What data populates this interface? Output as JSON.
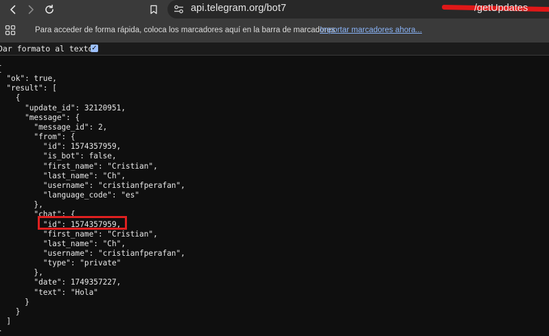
{
  "browser": {
    "url_start": "api.telegram.org/bot7",
    "url_end": "/getUpdates",
    "icons": {
      "back": "arrow-left-icon",
      "forward": "arrow-right-icon",
      "reload": "reload-icon",
      "bookmark": "bookmark-icon",
      "site_info": "tune-icon",
      "apps": "apps-grid-icon"
    }
  },
  "bookmarks_bar": {
    "message": "Para acceder de forma rápida, coloca los marcadores aquí en la barra de marcadores",
    "import_link": "Importar marcadores ahora..."
  },
  "pretty_print": {
    "label": "Dar formato al texto",
    "checked": true
  },
  "json_lines": [
    "{",
    "  \"ok\": true,",
    "  \"result\": [",
    "    {",
    "      \"update_id\": 32120951,",
    "      \"message\": {",
    "        \"message_id\": 2,",
    "        \"from\": {",
    "          \"id\": 1574357959,",
    "          \"is_bot\": false,",
    "          \"first_name\": \"Cristian\",",
    "          \"last_name\": \"Ch\",",
    "          \"username\": \"cristianfperafan\",",
    "          \"language_code\": \"es\"",
    "        },",
    "        \"chat\": {",
    "          \"id\": 1574357959,",
    "          \"first_name\": \"Cristian\",",
    "          \"last_name\": \"Ch\",",
    "          \"username\": \"cristianfperafan\",",
    "          \"type\": \"private\"",
    "        },",
    "        \"date\": 1749357227,",
    "        \"text\": \"Hola\"",
    "      }",
    "    }",
    "  ]",
    "}"
  ],
  "colors": {
    "highlight": "#e02020",
    "redaction": "#e01818",
    "link": "#8ab4f8"
  }
}
